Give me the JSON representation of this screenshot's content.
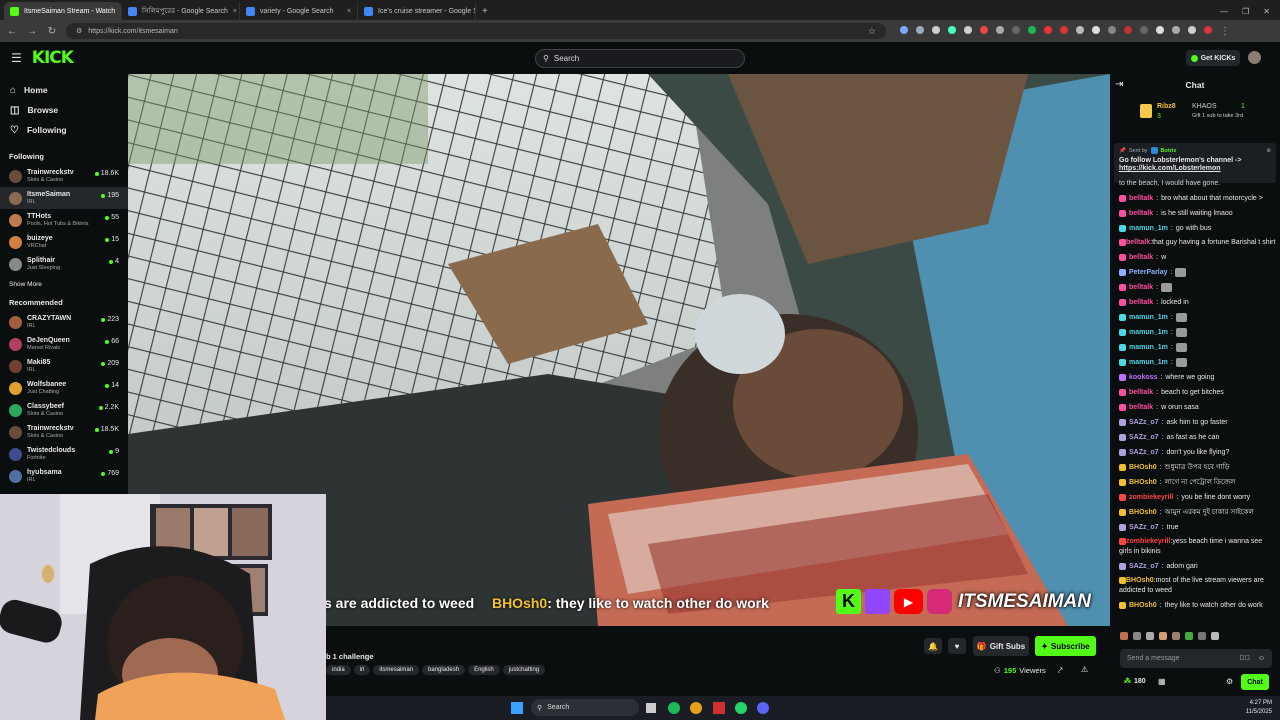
{
  "browser": {
    "tabs": [
      {
        "title": "ItsmeSaiman Stream - Watch",
        "color": "#53fc18",
        "active": true
      },
      {
        "title": "সিলিমপুরের - Google Search",
        "color": "#4285f4",
        "active": false
      },
      {
        "title": "variety - Google Search",
        "color": "#4285f4",
        "active": false
      },
      {
        "title": "Ice's cruise streamer - Google S",
        "color": "#4285f4",
        "active": false
      }
    ],
    "new_tab": "+",
    "url": "https://kick.com/itsmesaiman"
  },
  "header": {
    "logo": "KICK",
    "search_placeholder": "Search",
    "get_kicks": "Get KICKs"
  },
  "sidebar": {
    "nav": [
      {
        "label": "Home",
        "icon": "home-icon"
      },
      {
        "label": "Browse",
        "icon": "browse-icon"
      },
      {
        "label": "Following",
        "icon": "heart-icon"
      }
    ],
    "following_title": "Following",
    "following": [
      {
        "name": "Trainwreckstv",
        "category": "Slots & Casino",
        "viewers": "18.6K",
        "color": "#6a4a3a"
      },
      {
        "name": "ItsmeSaiman",
        "category": "IRL",
        "viewers": "195",
        "color": "#8a6a50"
      },
      {
        "name": "TTHots",
        "category": "Pools, Hot Tubs & Bikinis",
        "viewers": "55",
        "color": "#c07a50"
      },
      {
        "name": "buizeye",
        "category": "VRChat",
        "viewers": "15",
        "color": "#d08040"
      },
      {
        "name": "Splithair",
        "category": "Just Sleeping",
        "viewers": "4",
        "color": "#888"
      }
    ],
    "show_more": "Show More",
    "recommended_title": "Recommended",
    "recommended": [
      {
        "name": "CRAZYTAWN",
        "category": "IRL",
        "viewers": "223",
        "color": "#a06040"
      },
      {
        "name": "DeJenQueen",
        "category": "Marvel Rivals",
        "viewers": "66",
        "color": "#b04060"
      },
      {
        "name": "Maki85",
        "category": "IRL",
        "viewers": "209",
        "color": "#704030"
      },
      {
        "name": "Wolfsbanee",
        "category": "Just Chatting",
        "viewers": "14",
        "color": "#e0a030"
      },
      {
        "name": "Classybeef",
        "category": "Slots & Casino",
        "viewers": "2.2K",
        "color": "#2aa860"
      },
      {
        "name": "Trainwreckstv",
        "category": "Slots & Casino",
        "viewers": "18.5K",
        "color": "#6a4a3a"
      },
      {
        "name": "Twistedclouds",
        "category": "Fortnite",
        "viewers": "9",
        "color": "#404a90"
      },
      {
        "name": "hyubsama",
        "category": "IRL",
        "viewers": "769",
        "color": "#5070a0"
      }
    ]
  },
  "video": {
    "caption_prefix": "s are addicted to weed",
    "caption_user": "BHOsh0",
    "caption_text": ": they like to watch other do work",
    "overlay_name": "ITSMESAIMAN"
  },
  "stream_info": {
    "title_fragment": "b 1 challenge",
    "tags": [
      "india",
      "irl",
      "itsmesaiman",
      "bangladesh",
      "English",
      "justchatting"
    ],
    "gift_subs": "Gift Subs",
    "subscribe": "Subscribe",
    "viewers_count": "195",
    "viewers_label": "Viewers"
  },
  "chat": {
    "title": "Chat",
    "leaderboard": {
      "rank1_name": "Ribz8",
      "rank1_count": "3",
      "rank2_name": "KHAOS",
      "rank2_count": "1",
      "gift_note": "Gift 1 sub to take 3rd"
    },
    "pinned": {
      "sent_by": "Sent by",
      "bot": "Botrix",
      "text": "Go follow Lobsterlemon's channel ->",
      "link": "https://kick.com/Lobsterlemon"
    },
    "fragment": "to the beach, I would have gone.",
    "messages": [
      {
        "user": "belltalk",
        "text": "bro what about that motorcycle >",
        "color": "#ff4fa0"
      },
      {
        "user": "belltalk",
        "text": "is he still waiting lmaoo",
        "color": "#ff4fa0"
      },
      {
        "user": "mamun_1m",
        "text": "go with bus",
        "color": "#4dd8e8"
      },
      {
        "user": "belltalk",
        "text": "that guy having a fortune Barishal t shirt",
        "color": "#ff4fa0"
      },
      {
        "user": "belltalk",
        "text": "w",
        "color": "#ff4fa0"
      },
      {
        "user": "PeterParlay",
        "text": "",
        "color": "#8fb0ff"
      },
      {
        "user": "belltalk",
        "text": "",
        "color": "#ff4fa0"
      },
      {
        "user": "belltalk",
        "text": "locked in",
        "color": "#ff4fa0"
      },
      {
        "user": "mamun_1m",
        "text": "",
        "color": "#4dd8e8"
      },
      {
        "user": "mamun_1m",
        "text": "",
        "color": "#4dd8e8"
      },
      {
        "user": "mamun_1m",
        "text": "",
        "color": "#4dd8e8"
      },
      {
        "user": "mamun_1m",
        "text": "",
        "color": "#4dd8e8"
      },
      {
        "user": "kookoss",
        "text": "where we going",
        "color": "#c070ff"
      },
      {
        "user": "belltalk",
        "text": "beach to get bitches",
        "color": "#ff4fa0"
      },
      {
        "user": "belltalk",
        "text": "w orun sasa",
        "color": "#ff4fa0"
      },
      {
        "user": "SAZz_o7",
        "text": "ask him to go faster",
        "color": "#b0a0e0"
      },
      {
        "user": "SAZz_o7",
        "text": "as fast as he can",
        "color": "#b0a0e0"
      },
      {
        "user": "SAZz_o7",
        "text": "don't you like flying?",
        "color": "#b0a0e0"
      },
      {
        "user": "BHOsh0",
        "text": "শুধুমাত্র উপর হবে গাড়ি",
        "color": "#f0c030"
      },
      {
        "user": "BHOsh0",
        "text": "লাগে না পেট্রোল ডিজেল",
        "color": "#f0c030"
      },
      {
        "user": "zombiekeyrill",
        "text": "you be fine dont worry",
        "color": "#ff4444"
      },
      {
        "user": "BHOsh0",
        "text": "আমুন এরকম দুই চাকার সাইকেল",
        "color": "#f0c030"
      },
      {
        "user": "SAZz_o7",
        "text": "true",
        "color": "#b0a0e0"
      },
      {
        "user": "zombiekeyrill",
        "text": "yess beach time i wanna see girls in bikinis",
        "color": "#ff4444"
      },
      {
        "user": "SAZz_o7",
        "text": "adom gari",
        "color": "#b0a0e0"
      },
      {
        "user": "BHOsh0",
        "text": "most of the live stream viewers are addicted to weed",
        "color": "#f0c030"
      },
      {
        "user": "BHOsh0",
        "text": "they like to watch other do work",
        "color": "#f0c030"
      }
    ],
    "input_placeholder": "Send a message",
    "kicks_count": "180",
    "chat_button": "Chat"
  },
  "taskbar": {
    "search_placeholder": "Search",
    "time": "4:27 PM",
    "date": "11/5/2025"
  },
  "colors": {
    "accent": "#53fc18",
    "background": "#0b0e0f",
    "panel": "#24272c"
  }
}
